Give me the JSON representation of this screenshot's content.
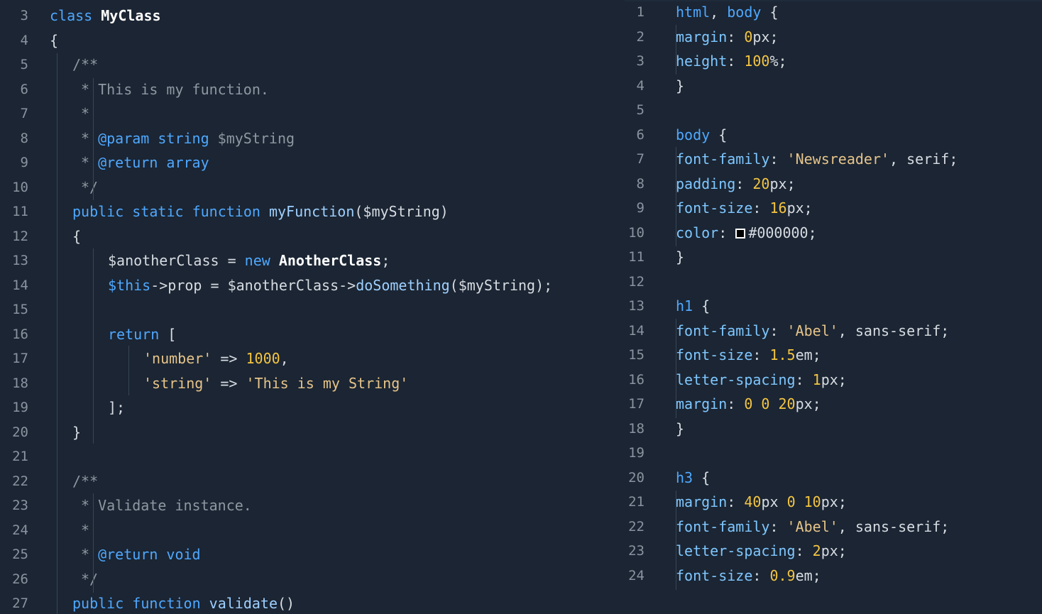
{
  "colors": {
    "background": "#1b2533",
    "keyword": "#4fa8ff",
    "string": "#e6c48a",
    "number": "#f4c542",
    "comment": "#8e98a2"
  },
  "left_editor": {
    "lines": [
      {
        "n": "3",
        "tokens": [
          {
            "t": "class ",
            "c": "kw"
          },
          {
            "t": "MyClass",
            "c": "cls"
          }
        ]
      },
      {
        "n": "4",
        "tokens": [
          {
            "t": "{",
            "c": "punc"
          }
        ]
      },
      {
        "n": "5",
        "tokens": [
          {
            "t": "/**",
            "c": "cmt"
          }
        ],
        "indent": 1
      },
      {
        "n": "6",
        "tokens": [
          {
            "t": "* This is my function.",
            "c": "cmt"
          }
        ],
        "indent": 1,
        "ci": true
      },
      {
        "n": "7",
        "tokens": [
          {
            "t": "*",
            "c": "cmt"
          }
        ],
        "indent": 1,
        "ci": true
      },
      {
        "n": "8",
        "tokens": [
          {
            "t": "* ",
            "c": "cmt"
          },
          {
            "t": "@param string ",
            "c": "doc"
          },
          {
            "t": "$myString",
            "c": "cmt"
          }
        ],
        "indent": 1,
        "ci": true
      },
      {
        "n": "9",
        "tokens": [
          {
            "t": "* ",
            "c": "cmt"
          },
          {
            "t": "@return array",
            "c": "doc"
          }
        ],
        "indent": 1,
        "ci": true
      },
      {
        "n": "10",
        "tokens": [
          {
            "t": "*/",
            "c": "cmt"
          }
        ],
        "indent": 1,
        "ci": true
      },
      {
        "n": "11",
        "tokens": [
          {
            "t": "public static function ",
            "c": "kw"
          },
          {
            "t": "myFunction",
            "c": "fn"
          },
          {
            "t": "($myString)",
            "c": "var"
          }
        ],
        "indent": 1
      },
      {
        "n": "12",
        "tokens": [
          {
            "t": "{",
            "c": "punc"
          }
        ],
        "indent": 1
      },
      {
        "n": "13",
        "tokens": [
          {
            "t": "$anotherClass = ",
            "c": "var"
          },
          {
            "t": "new ",
            "c": "kw"
          },
          {
            "t": "AnotherClass",
            "c": "cls"
          },
          {
            "t": ";",
            "c": "punc"
          }
        ],
        "indent": 2
      },
      {
        "n": "14",
        "tokens": [
          {
            "t": "$this",
            "c": "kw"
          },
          {
            "t": "->prop = $anotherClass->",
            "c": "var"
          },
          {
            "t": "doSomething",
            "c": "fn"
          },
          {
            "t": "($myString);",
            "c": "var"
          }
        ],
        "indent": 2
      },
      {
        "n": "15",
        "tokens": []
      },
      {
        "n": "16",
        "tokens": [
          {
            "t": "return ",
            "c": "kw"
          },
          {
            "t": "[",
            "c": "punc"
          }
        ],
        "indent": 2
      },
      {
        "n": "17",
        "tokens": [
          {
            "t": "'number'",
            "c": "str"
          },
          {
            "t": " => ",
            "c": "punc"
          },
          {
            "t": "1000",
            "c": "num"
          },
          {
            "t": ",",
            "c": "punc"
          }
        ],
        "indent": 3
      },
      {
        "n": "18",
        "tokens": [
          {
            "t": "'string'",
            "c": "str"
          },
          {
            "t": " => ",
            "c": "punc"
          },
          {
            "t": "'This is my String'",
            "c": "str"
          }
        ],
        "indent": 3
      },
      {
        "n": "19",
        "tokens": [
          {
            "t": "];",
            "c": "punc"
          }
        ],
        "indent": 2
      },
      {
        "n": "20",
        "tokens": [
          {
            "t": "}",
            "c": "punc"
          }
        ],
        "indent": 1
      },
      {
        "n": "21",
        "tokens": []
      },
      {
        "n": "22",
        "tokens": [
          {
            "t": "/**",
            "c": "cmt"
          }
        ],
        "indent": 1
      },
      {
        "n": "23",
        "tokens": [
          {
            "t": "* Validate instance.",
            "c": "cmt"
          }
        ],
        "indent": 1,
        "ci": true
      },
      {
        "n": "24",
        "tokens": [
          {
            "t": "*",
            "c": "cmt"
          }
        ],
        "indent": 1,
        "ci": true
      },
      {
        "n": "25",
        "tokens": [
          {
            "t": "* ",
            "c": "cmt"
          },
          {
            "t": "@return void",
            "c": "doc"
          }
        ],
        "indent": 1,
        "ci": true
      },
      {
        "n": "26",
        "tokens": [
          {
            "t": "*/",
            "c": "cmt"
          }
        ],
        "indent": 1,
        "ci": true
      },
      {
        "n": "27",
        "tokens": [
          {
            "t": "public function ",
            "c": "kw"
          },
          {
            "t": "validate",
            "c": "fn"
          },
          {
            "t": "()",
            "c": "punc"
          }
        ],
        "indent": 1
      }
    ]
  },
  "right_editor": {
    "lines": [
      {
        "n": "1",
        "tokens": [
          {
            "t": "html",
            "c": "sel"
          },
          {
            "t": ", ",
            "c": "punc"
          },
          {
            "t": "body",
            "c": "sel"
          },
          {
            "t": " {",
            "c": "punc"
          }
        ]
      },
      {
        "n": "2",
        "tokens": [
          {
            "t": "margin",
            "c": "prop"
          },
          {
            "t": ": ",
            "c": "punc"
          },
          {
            "t": "0",
            "c": "num"
          },
          {
            "t": "px;",
            "c": "punc"
          }
        ],
        "indent": 1
      },
      {
        "n": "3",
        "tokens": [
          {
            "t": "height",
            "c": "prop"
          },
          {
            "t": ": ",
            "c": "punc"
          },
          {
            "t": "100",
            "c": "num"
          },
          {
            "t": "%;",
            "c": "punc"
          }
        ],
        "indent": 1
      },
      {
        "n": "4",
        "tokens": [
          {
            "t": "}",
            "c": "punc"
          }
        ]
      },
      {
        "n": "5",
        "tokens": []
      },
      {
        "n": "6",
        "tokens": [
          {
            "t": "body",
            "c": "sel"
          },
          {
            "t": " {",
            "c": "punc"
          }
        ]
      },
      {
        "n": "7",
        "tokens": [
          {
            "t": "font-family",
            "c": "prop"
          },
          {
            "t": ": ",
            "c": "punc"
          },
          {
            "t": "'Newsreader'",
            "c": "str"
          },
          {
            "t": ", serif;",
            "c": "punc"
          }
        ],
        "indent": 1
      },
      {
        "n": "8",
        "tokens": [
          {
            "t": "padding",
            "c": "prop"
          },
          {
            "t": ": ",
            "c": "punc"
          },
          {
            "t": "20",
            "c": "num"
          },
          {
            "t": "px;",
            "c": "punc"
          }
        ],
        "indent": 1
      },
      {
        "n": "9",
        "tokens": [
          {
            "t": "font-size",
            "c": "prop"
          },
          {
            "t": ": ",
            "c": "punc"
          },
          {
            "t": "16",
            "c": "num"
          },
          {
            "t": "px;",
            "c": "punc"
          }
        ],
        "indent": 1
      },
      {
        "n": "10",
        "tokens": [
          {
            "t": "color",
            "c": "prop"
          },
          {
            "t": ": ",
            "c": "punc"
          },
          {
            "t": "#000000",
            "c": "punc",
            "swatch": true
          },
          {
            "t": ";",
            "c": "punc"
          }
        ],
        "indent": 1
      },
      {
        "n": "11",
        "tokens": [
          {
            "t": "}",
            "c": "punc"
          }
        ]
      },
      {
        "n": "12",
        "tokens": []
      },
      {
        "n": "13",
        "tokens": [
          {
            "t": "h1",
            "c": "sel"
          },
          {
            "t": " {",
            "c": "punc"
          }
        ]
      },
      {
        "n": "14",
        "tokens": [
          {
            "t": "font-family",
            "c": "prop"
          },
          {
            "t": ": ",
            "c": "punc"
          },
          {
            "t": "'Abel'",
            "c": "str"
          },
          {
            "t": ", sans-serif;",
            "c": "punc"
          }
        ],
        "indent": 1
      },
      {
        "n": "15",
        "tokens": [
          {
            "t": "font-size",
            "c": "prop"
          },
          {
            "t": ": ",
            "c": "punc"
          },
          {
            "t": "1.5",
            "c": "num"
          },
          {
            "t": "em;",
            "c": "punc"
          }
        ],
        "indent": 1
      },
      {
        "n": "16",
        "tokens": [
          {
            "t": "letter-spacing",
            "c": "prop"
          },
          {
            "t": ": ",
            "c": "punc"
          },
          {
            "t": "1",
            "c": "num"
          },
          {
            "t": "px;",
            "c": "punc"
          }
        ],
        "indent": 1
      },
      {
        "n": "17",
        "tokens": [
          {
            "t": "margin",
            "c": "prop"
          },
          {
            "t": ": ",
            "c": "punc"
          },
          {
            "t": "0 0 20",
            "c": "num"
          },
          {
            "t": "px;",
            "c": "punc"
          }
        ],
        "indent": 1
      },
      {
        "n": "18",
        "tokens": [
          {
            "t": "}",
            "c": "punc"
          }
        ]
      },
      {
        "n": "19",
        "tokens": []
      },
      {
        "n": "20",
        "tokens": [
          {
            "t": "h3",
            "c": "sel"
          },
          {
            "t": " {",
            "c": "punc"
          }
        ]
      },
      {
        "n": "21",
        "tokens": [
          {
            "t": "margin",
            "c": "prop"
          },
          {
            "t": ": ",
            "c": "punc"
          },
          {
            "t": "40",
            "c": "num"
          },
          {
            "t": "px ",
            "c": "punc"
          },
          {
            "t": "0 10",
            "c": "num"
          },
          {
            "t": "px;",
            "c": "punc"
          }
        ],
        "indent": 1
      },
      {
        "n": "22",
        "tokens": [
          {
            "t": "font-family",
            "c": "prop"
          },
          {
            "t": ": ",
            "c": "punc"
          },
          {
            "t": "'Abel'",
            "c": "str"
          },
          {
            "t": ", sans-serif;",
            "c": "punc"
          }
        ],
        "indent": 1
      },
      {
        "n": "23",
        "tokens": [
          {
            "t": "letter-spacing",
            "c": "prop"
          },
          {
            "t": ": ",
            "c": "punc"
          },
          {
            "t": "2",
            "c": "num"
          },
          {
            "t": "px;",
            "c": "punc"
          }
        ],
        "indent": 1
      },
      {
        "n": "24",
        "tokens": [
          {
            "t": "font-size",
            "c": "prop"
          },
          {
            "t": ": ",
            "c": "punc"
          },
          {
            "t": "0.9",
            "c": "num"
          },
          {
            "t": "em;",
            "c": "punc"
          }
        ],
        "indent": 1
      }
    ]
  }
}
